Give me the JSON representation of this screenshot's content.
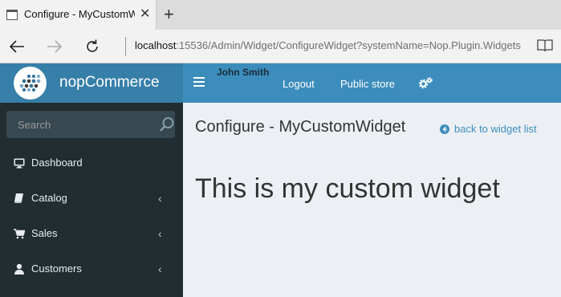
{
  "browser": {
    "tab_title": "Configure - MyCustomW",
    "tab_close": "✕",
    "new_tab": "+",
    "url_host": "localhost",
    "url_path": ":15536/Admin/Widget/ConfigureWidget?systemName=Nop.Plugin.Widgets"
  },
  "header": {
    "logo_text": "nopCommerce",
    "user_name": "John Smith",
    "logout_label": "Logout",
    "public_store_label": "Public store"
  },
  "sidebar": {
    "search_placeholder": "Search",
    "items": [
      {
        "label": "Dashboard",
        "has_chevron": false
      },
      {
        "label": "Catalog",
        "has_chevron": true
      },
      {
        "label": "Sales",
        "has_chevron": true
      },
      {
        "label": "Customers",
        "has_chevron": true
      }
    ],
    "chevron": "‹"
  },
  "content": {
    "page_title": "Configure - MyCustomWidget",
    "back_link": "back to widget list",
    "widget_text": "This is my custom widget"
  },
  "colors": {
    "header": "#3c8dbc",
    "logo_bg": "#367fa9",
    "sidebar": "#222d32",
    "content_bg": "#ecf0f5",
    "link": "#3c8dbc"
  }
}
